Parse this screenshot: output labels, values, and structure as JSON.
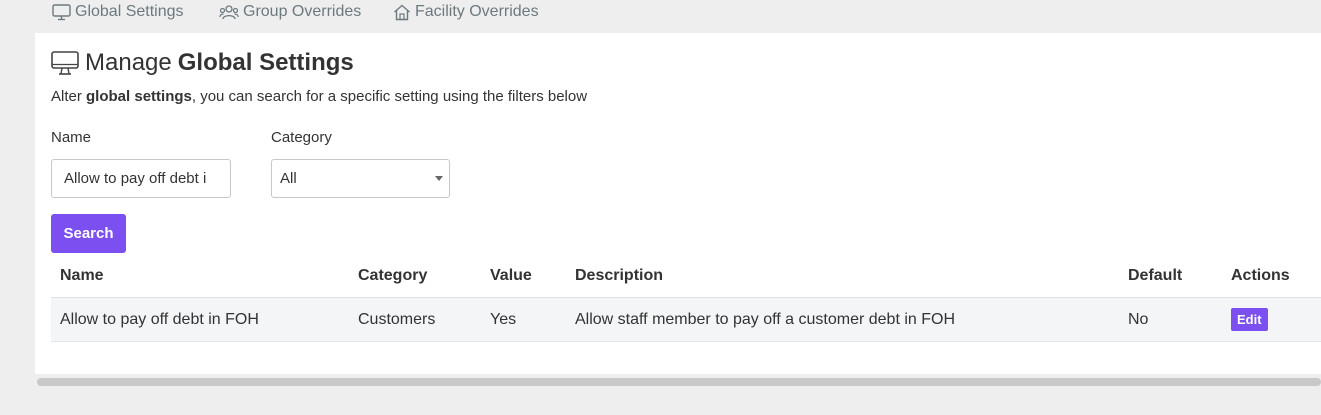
{
  "tabs": [
    {
      "label": "Global Settings",
      "icon": "monitor-icon"
    },
    {
      "label": "Group Overrides",
      "icon": "users-icon"
    },
    {
      "label": "Facility Overrides",
      "icon": "home-icon"
    }
  ],
  "page": {
    "title_prefix": "Manage",
    "title_bold": "Global Settings",
    "subtitle_prefix": "Alter ",
    "subtitle_bold": "global settings",
    "subtitle_suffix": ", you can search for a specific setting using the filters below"
  },
  "filters": {
    "name_label": "Name",
    "name_value": "Allow to pay off debt i",
    "category_label": "Category",
    "category_value": "All",
    "search_label": "Search"
  },
  "table": {
    "headers": [
      "Name",
      "Category",
      "Value",
      "Description",
      "Default",
      "Actions"
    ],
    "rows": [
      {
        "name": "Allow to pay off debt in FOH",
        "category": "Customers",
        "value": "Yes",
        "description": "Allow staff member to pay off a customer debt in FOH",
        "default": "No",
        "action": "Edit"
      }
    ]
  },
  "colors": {
    "accent": "#7b4ff0",
    "background": "#eeeeee",
    "panel": "#ffffff",
    "tab_text": "#6c7a80"
  }
}
